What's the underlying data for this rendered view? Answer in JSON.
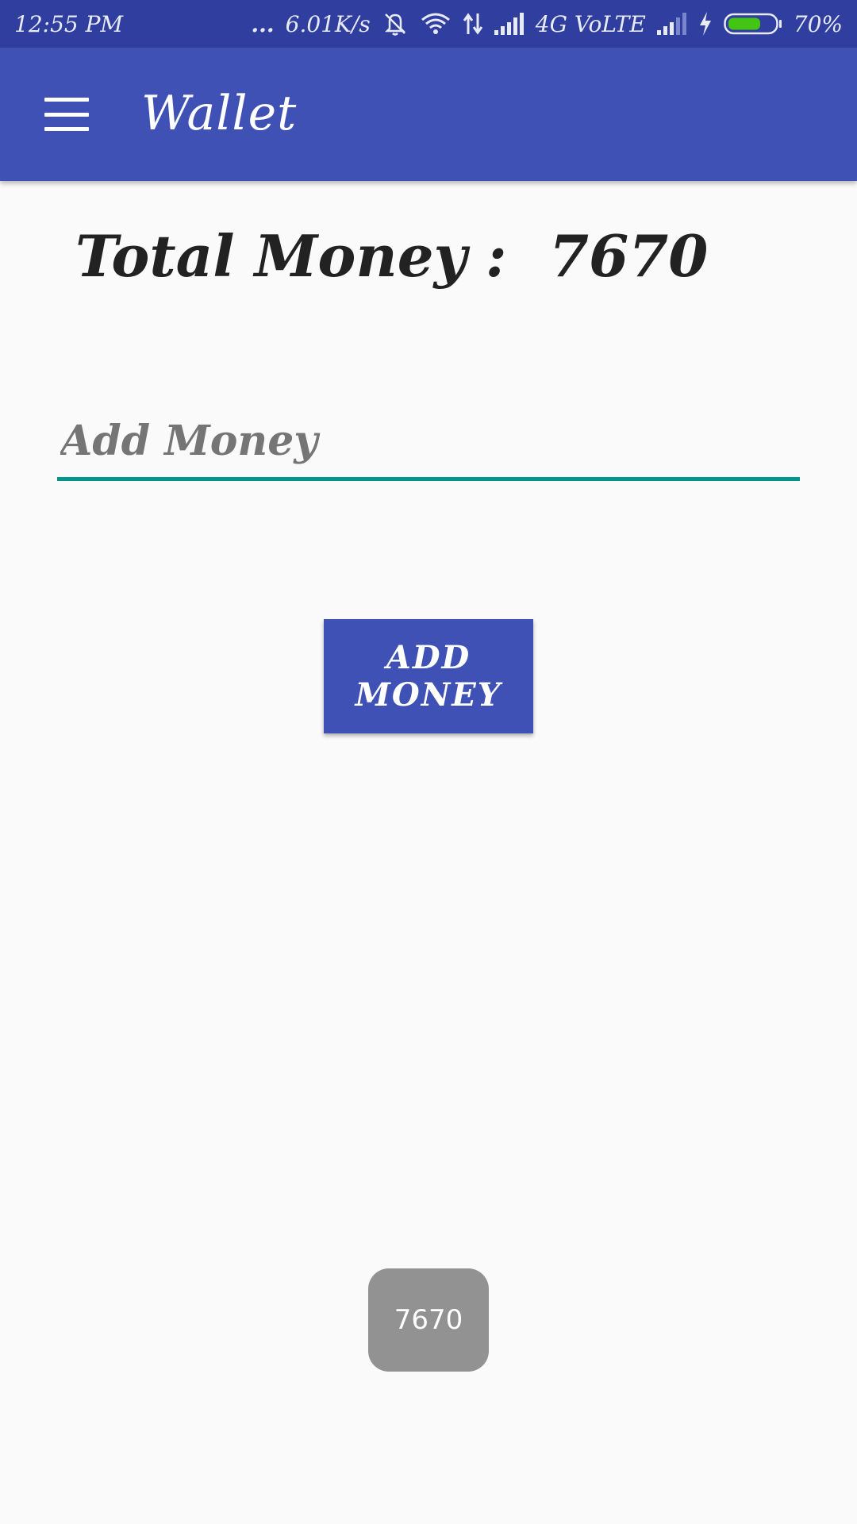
{
  "status_bar": {
    "time": "12:55 PM",
    "dots": "...",
    "speed": "6.01K/s",
    "network": "4G VoLTE",
    "battery_percent": "70%",
    "battery_level": 0.7,
    "icons": [
      "dots-icon",
      "mute-icon",
      "wifi-icon",
      "data-arrows-icon",
      "signal-icon",
      "signal-weak-icon",
      "charging-icon",
      "battery-icon"
    ]
  },
  "app_bar": {
    "title": "Wallet",
    "menu_icon": "hamburger-menu-icon"
  },
  "main": {
    "total_label": "Total Money",
    "colon": ":",
    "total_value": "7670",
    "input": {
      "placeholder": "Add Money",
      "value": ""
    },
    "add_button_label": "ADD MONEY"
  },
  "toast": {
    "text": "7670"
  },
  "colors": {
    "status_bar": "#303f9f",
    "app_bar": "#3f51b5",
    "accent": "#009688",
    "button": "#3f51b5",
    "toast": "#929292"
  }
}
